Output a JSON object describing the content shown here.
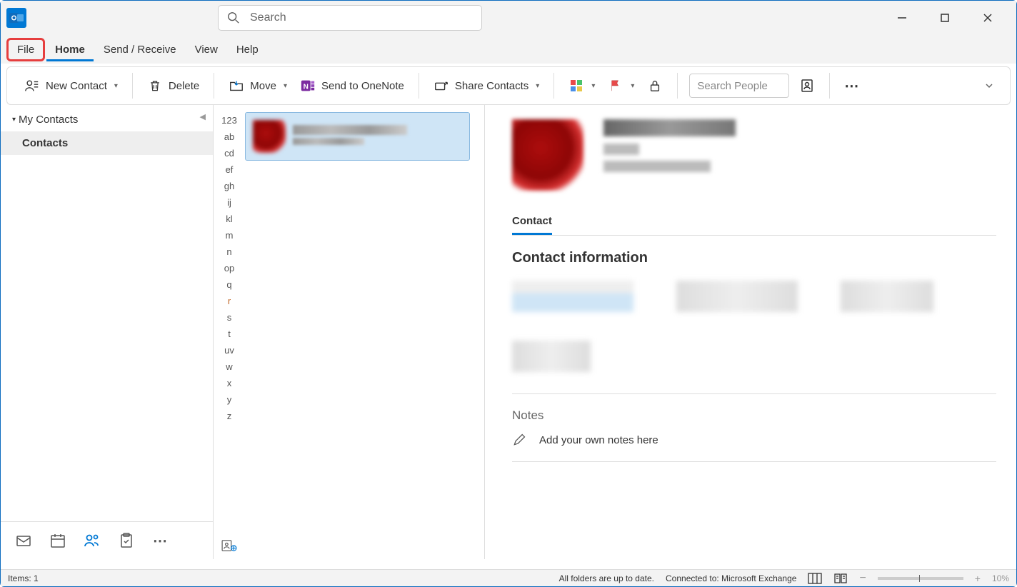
{
  "titlebar": {
    "search_placeholder": "Search"
  },
  "tabs": {
    "file": "File",
    "home": "Home",
    "send_receive": "Send / Receive",
    "view": "View",
    "help": "Help"
  },
  "ribbon": {
    "new_contact": "New Contact",
    "delete": "Delete",
    "move": "Move",
    "send_onenote": "Send to OneNote",
    "share_contacts": "Share Contacts",
    "search_people_placeholder": "Search People"
  },
  "nav": {
    "header": "My Contacts",
    "item_contacts": "Contacts"
  },
  "alpha_index": [
    "123",
    "ab",
    "cd",
    "ef",
    "gh",
    "ij",
    "kl",
    "m",
    "n",
    "op",
    "q",
    "r",
    "s",
    "t",
    "uv",
    "w",
    "x",
    "y",
    "z"
  ],
  "alpha_hot": [
    "r"
  ],
  "detail": {
    "tab_contact": "Contact",
    "section_info": "Contact information",
    "notes_title": "Notes",
    "notes_placeholder": "Add your own notes here"
  },
  "status": {
    "items": "Items: 1",
    "folders": "All folders are up to date.",
    "connected": "Connected to: Microsoft Exchange",
    "zoom": "10%"
  }
}
